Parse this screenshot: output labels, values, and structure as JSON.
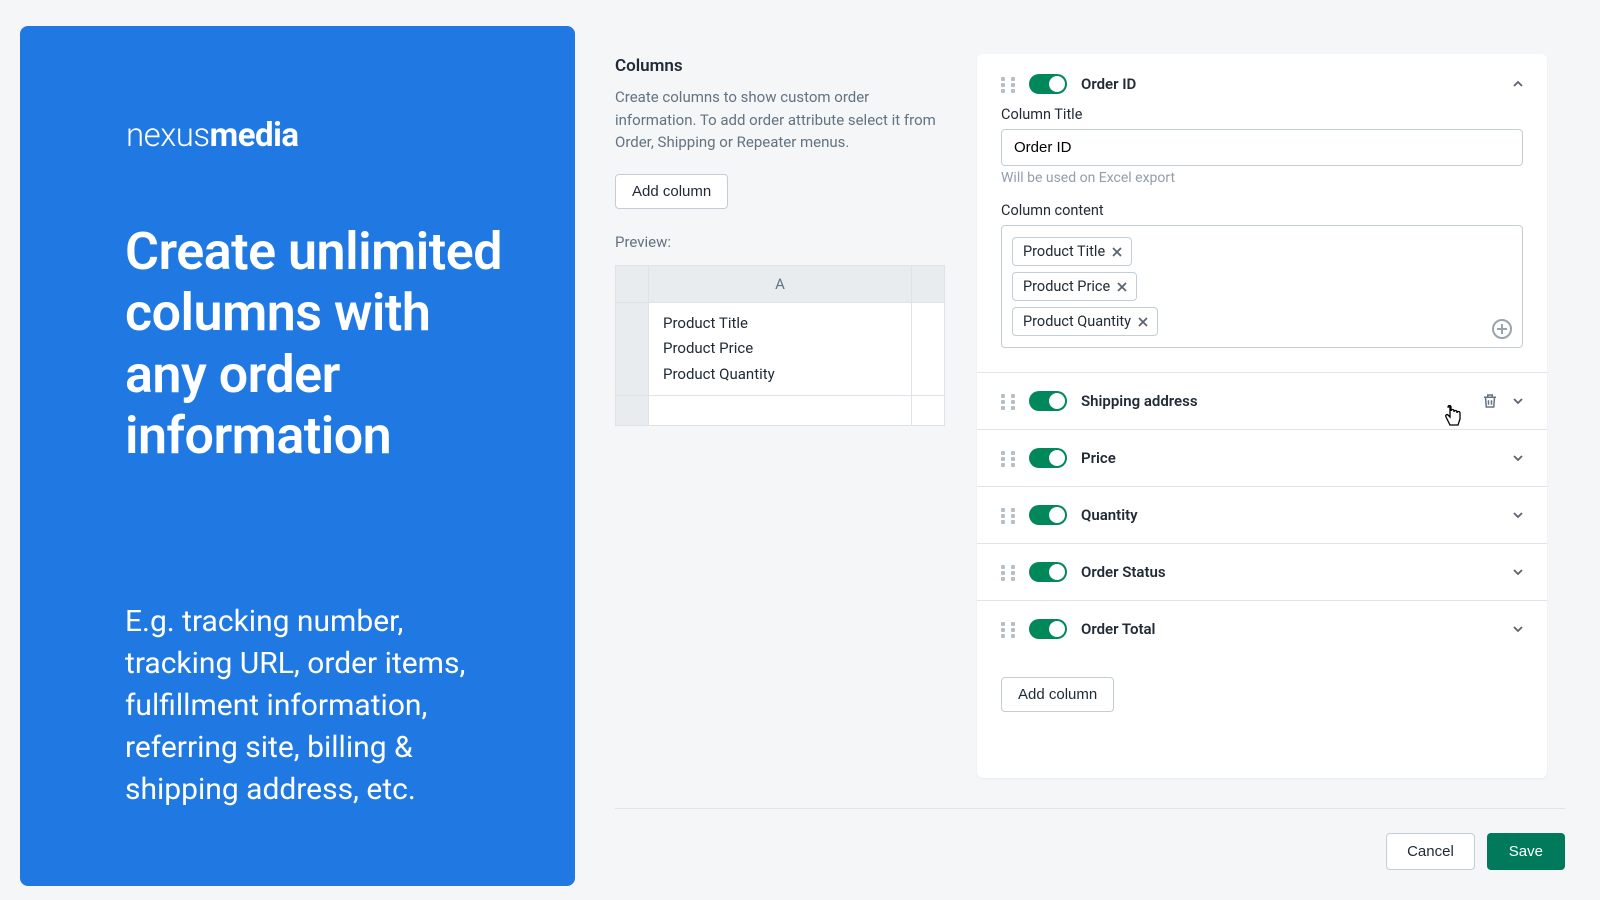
{
  "colors": {
    "accent": "#2079e3",
    "toggle_on": "#00875a",
    "primary_btn": "#007a5a"
  },
  "left_panel": {
    "logo_thin": "nexus",
    "logo_bold": "media",
    "headline": "Create unlimited columns with any order information",
    "subtext": "E.g. tracking number, tracking URL, order items, fulfillment information, referring site, billing & shipping address, etc."
  },
  "config": {
    "title": "Columns",
    "description": "Create columns to show custom order information. To add order attribute select it from Order, Shipping or Repeater menus.",
    "add_column_label": "Add column",
    "preview_label": "Preview:",
    "preview_header": "A",
    "preview_items": [
      "Product Title",
      "Product Price",
      "Product Quantity"
    ]
  },
  "expanded_column": {
    "title": "Order ID",
    "field_label_title": "Column Title",
    "field_value_title": "Order ID",
    "field_hint": "Will be used on Excel export",
    "field_label_content": "Column content",
    "tags": [
      "Product Title",
      "Product Price",
      "Product Quantity"
    ]
  },
  "collapsed_columns": [
    {
      "title": "Shipping address",
      "show_delete": true
    },
    {
      "title": "Price",
      "show_delete": false
    },
    {
      "title": "Quantity",
      "show_delete": false
    },
    {
      "title": "Order Status",
      "show_delete": false
    },
    {
      "title": "Order Total",
      "show_delete": false
    }
  ],
  "footer": {
    "cancel": "Cancel",
    "save": "Save",
    "add_column_bottom": "Add column"
  }
}
